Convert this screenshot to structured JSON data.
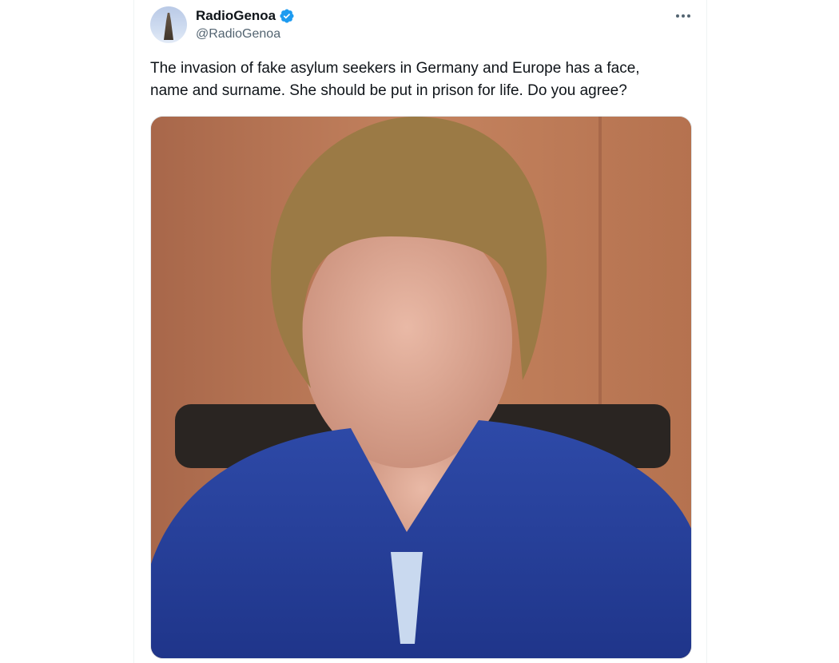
{
  "tweet": {
    "display_name": "RadioGenoa",
    "handle": "@RadioGenoa",
    "verified": true,
    "text": "The invasion of fake asylum seekers in Germany and Europe has a face,\nname and surname. She should be put in prison for life. Do you agree?",
    "media": {
      "description": "portrait photo"
    }
  },
  "icons": {
    "verified": "verified-badge-icon",
    "more": "more-options-icon"
  },
  "colors": {
    "verified_blue": "#1d9bf0",
    "text_primary": "#0f1419",
    "text_secondary": "#536471"
  }
}
